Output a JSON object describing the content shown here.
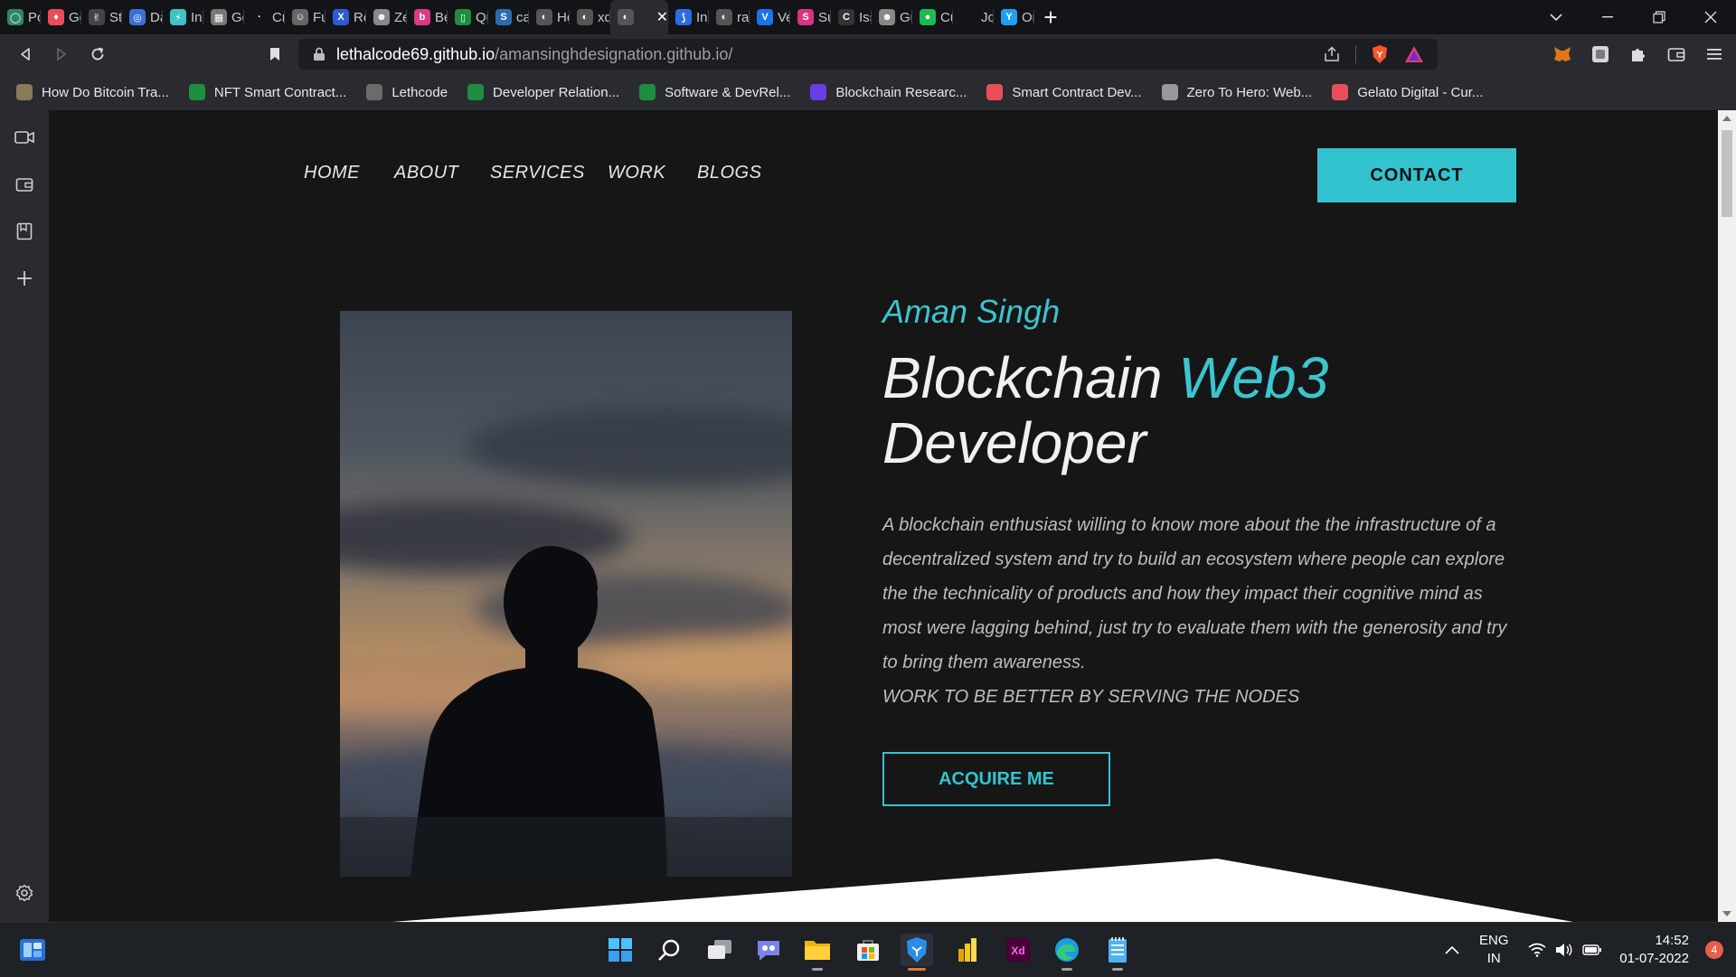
{
  "browser": {
    "tabs": [
      {
        "title": "Pos",
        "color": "#2b8a64",
        "glyph": "◯"
      },
      {
        "title": "Gel",
        "color": "#e94e58",
        "glyph": "♦"
      },
      {
        "title": "Sta",
        "color": "#444444",
        "glyph": "✌"
      },
      {
        "title": "Dap",
        "color": "#3b6fd6",
        "glyph": "◎"
      },
      {
        "title": "Inp",
        "color": "#3fc1c9",
        "glyph": "⚡"
      },
      {
        "title": "Get",
        "color": "#777777",
        "glyph": "▦"
      },
      {
        "title": "Cry",
        "color": "#131418",
        "glyph": "·"
      },
      {
        "title": "Fun",
        "color": "#666666",
        "glyph": "☺"
      },
      {
        "title": "Ren",
        "color": "#2c5ad6",
        "glyph": "X"
      },
      {
        "title": "Zer",
        "color": "#888888",
        "glyph": "☻"
      },
      {
        "title": "BeE",
        "color": "#d93a8a",
        "glyph": "b"
      },
      {
        "title": "Qua",
        "color": "#1e8e3e",
        "glyph": "▯"
      },
      {
        "title": "card",
        "color": "#2b6cb0",
        "glyph": "S"
      },
      {
        "title": "How",
        "color": "#555555",
        "glyph": "◐"
      },
      {
        "title": "xd.a",
        "color": "#555555",
        "glyph": "◐"
      },
      {
        "title": "",
        "color": "#555555",
        "glyph": "◐",
        "active": true
      },
      {
        "title": "Inst",
        "color": "#2d6cdf",
        "glyph": "⟆"
      },
      {
        "title": "rap",
        "color": "#555555",
        "glyph": "◐"
      },
      {
        "title": "Ver",
        "color": "#1a73e8",
        "glyph": "V"
      },
      {
        "title": "Sub",
        "color": "#d63384",
        "glyph": "S"
      },
      {
        "title": "Issu",
        "color": "#333333",
        "glyph": "C"
      },
      {
        "title": "Gui",
        "color": "#888888",
        "glyph": "☻"
      },
      {
        "title": "Cus",
        "color": "#1db954",
        "glyph": "●"
      },
      {
        "title": "Job",
        "color": "#131418",
        "glyph": ""
      },
      {
        "title": "Onl",
        "color": "#1da1f2",
        "glyph": "Y"
      }
    ],
    "close_tab_glyph": "✕",
    "new_tab_glyph": "+",
    "url_domain": "lethalcode69.github.io",
    "url_path": "/amansinghdesignation.github.io/"
  },
  "bookmarks": [
    {
      "label": "How Do Bitcoin Tra...",
      "color": "#8a7a55"
    },
    {
      "label": "NFT Smart Contract...",
      "color": "#1e8e3e"
    },
    {
      "label": "Lethcode",
      "color": "#6b6b6b"
    },
    {
      "label": "Developer Relation...",
      "color": "#1e8e3e"
    },
    {
      "label": "Software & DevRel...",
      "color": "#1e8e3e"
    },
    {
      "label": "Blockchain Researc...",
      "color": "#6a3de8"
    },
    {
      "label": "Smart Contract Dev...",
      "color": "#e94e58"
    },
    {
      "label": "Zero To Hero: Web...",
      "color": "#999999"
    },
    {
      "label": "Gelato Digital - Cur...",
      "color": "#e94e58"
    }
  ],
  "site": {
    "nav": [
      "HOME",
      "ABOUT",
      "SERVICES",
      "WORK",
      "BLOGS"
    ],
    "contact": "CONTACT",
    "name": "Aman Singh",
    "title_part1": "Blockchain ",
    "title_accent": "Web3",
    "title_part2": "Developer",
    "description": "A blockchain enthusiast willing to know more about the the infrastructure of a decentralized system and try to build an ecosystem where people can explore the the technicality of products and how they impact their cognitive mind as most were lagging behind, just try to evaluate them with the generosity and try to bring them awareness.",
    "motto": "WORK TO BE BETTER BY SERVING THE NODES",
    "cta": "ACQUIRE ME",
    "accent_color": "#33c3cf"
  },
  "taskbar": {
    "lang_line1": "ENG",
    "lang_line2": "IN",
    "time": "14:52",
    "date": "01-07-2022",
    "notifications": "4"
  }
}
